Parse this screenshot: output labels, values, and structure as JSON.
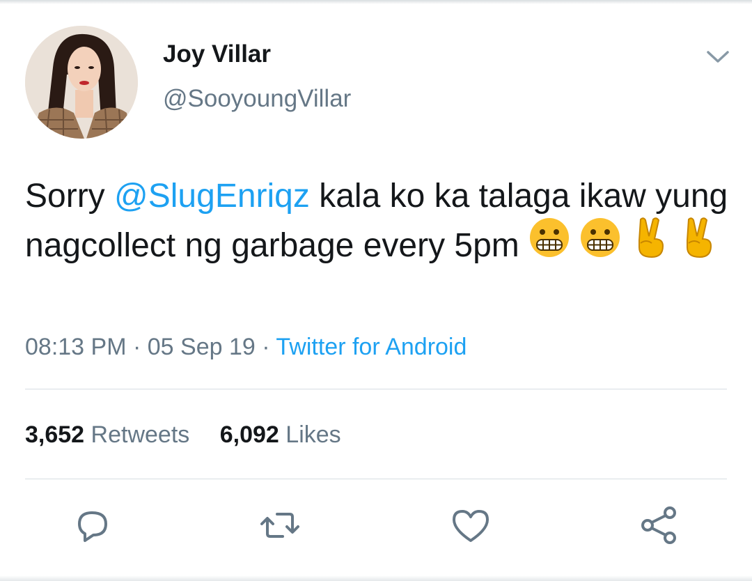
{
  "tweet": {
    "author": {
      "display_name": "Joy Villar",
      "handle": "@SooyoungVillar"
    },
    "text": {
      "before_mention": "Sorry ",
      "mention": "@SlugEnriqz",
      "after_mention": " kala ko ka talaga ikaw yung nagcollect ng garbage every 5pm",
      "emojis": [
        "grimacing-face",
        "grimacing-face",
        "victory-hand",
        "victory-hand"
      ]
    },
    "meta": {
      "time": "08:13 PM",
      "separator": " · ",
      "date": "05 Sep 19",
      "source": "Twitter for Android"
    },
    "stats": {
      "retweets_count": "3,652",
      "retweets_label": "Retweets",
      "likes_count": "6,092",
      "likes_label": "Likes"
    }
  },
  "colors": {
    "link": "#1da1f2",
    "secondary_text": "#657786",
    "primary_text": "#14171a",
    "divider": "#d6dde2"
  },
  "icons": [
    "chevron-down-icon",
    "reply-icon",
    "retweet-icon",
    "like-icon",
    "share-icon"
  ]
}
